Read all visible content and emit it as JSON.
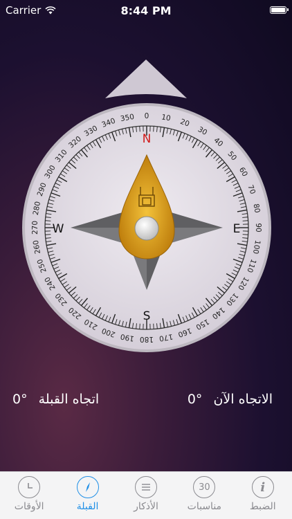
{
  "status": {
    "carrier": "Carrier",
    "time": "8:44 PM"
  },
  "compass": {
    "cardinals": {
      "n": "N",
      "e": "E",
      "s": "S",
      "w": "W"
    },
    "degree_labels": [
      "0",
      "10",
      "20",
      "30",
      "40",
      "50",
      "60",
      "70",
      "80",
      "90",
      "100",
      "110",
      "120",
      "130",
      "140",
      "150",
      "160",
      "170",
      "180",
      "190",
      "200",
      "210",
      "220",
      "230",
      "240",
      "250",
      "260",
      "270",
      "280",
      "290",
      "300",
      "310",
      "320",
      "330",
      "340",
      "350"
    ],
    "heading_degrees": 0
  },
  "readings": {
    "current_label": "الاتجاه الآن",
    "current_value": "0°",
    "qibla_label": "اتجاه القبلة",
    "qibla_value": "0°"
  },
  "tabs": [
    {
      "label": "الضبط",
      "icon": "info-icon",
      "active": false
    },
    {
      "label": "مناسبات",
      "icon": "calendar-30-icon",
      "icon_text": "30",
      "active": false
    },
    {
      "label": "الأذكار",
      "icon": "list-icon",
      "active": false
    },
    {
      "label": "القبلة",
      "icon": "compass-icon",
      "active": true
    },
    {
      "label": "الأوقات",
      "icon": "clock-icon",
      "active": false
    }
  ],
  "colors": {
    "accent": "#1f8fe6",
    "needle": "#d49a1a",
    "north": "#d11b1b"
  }
}
